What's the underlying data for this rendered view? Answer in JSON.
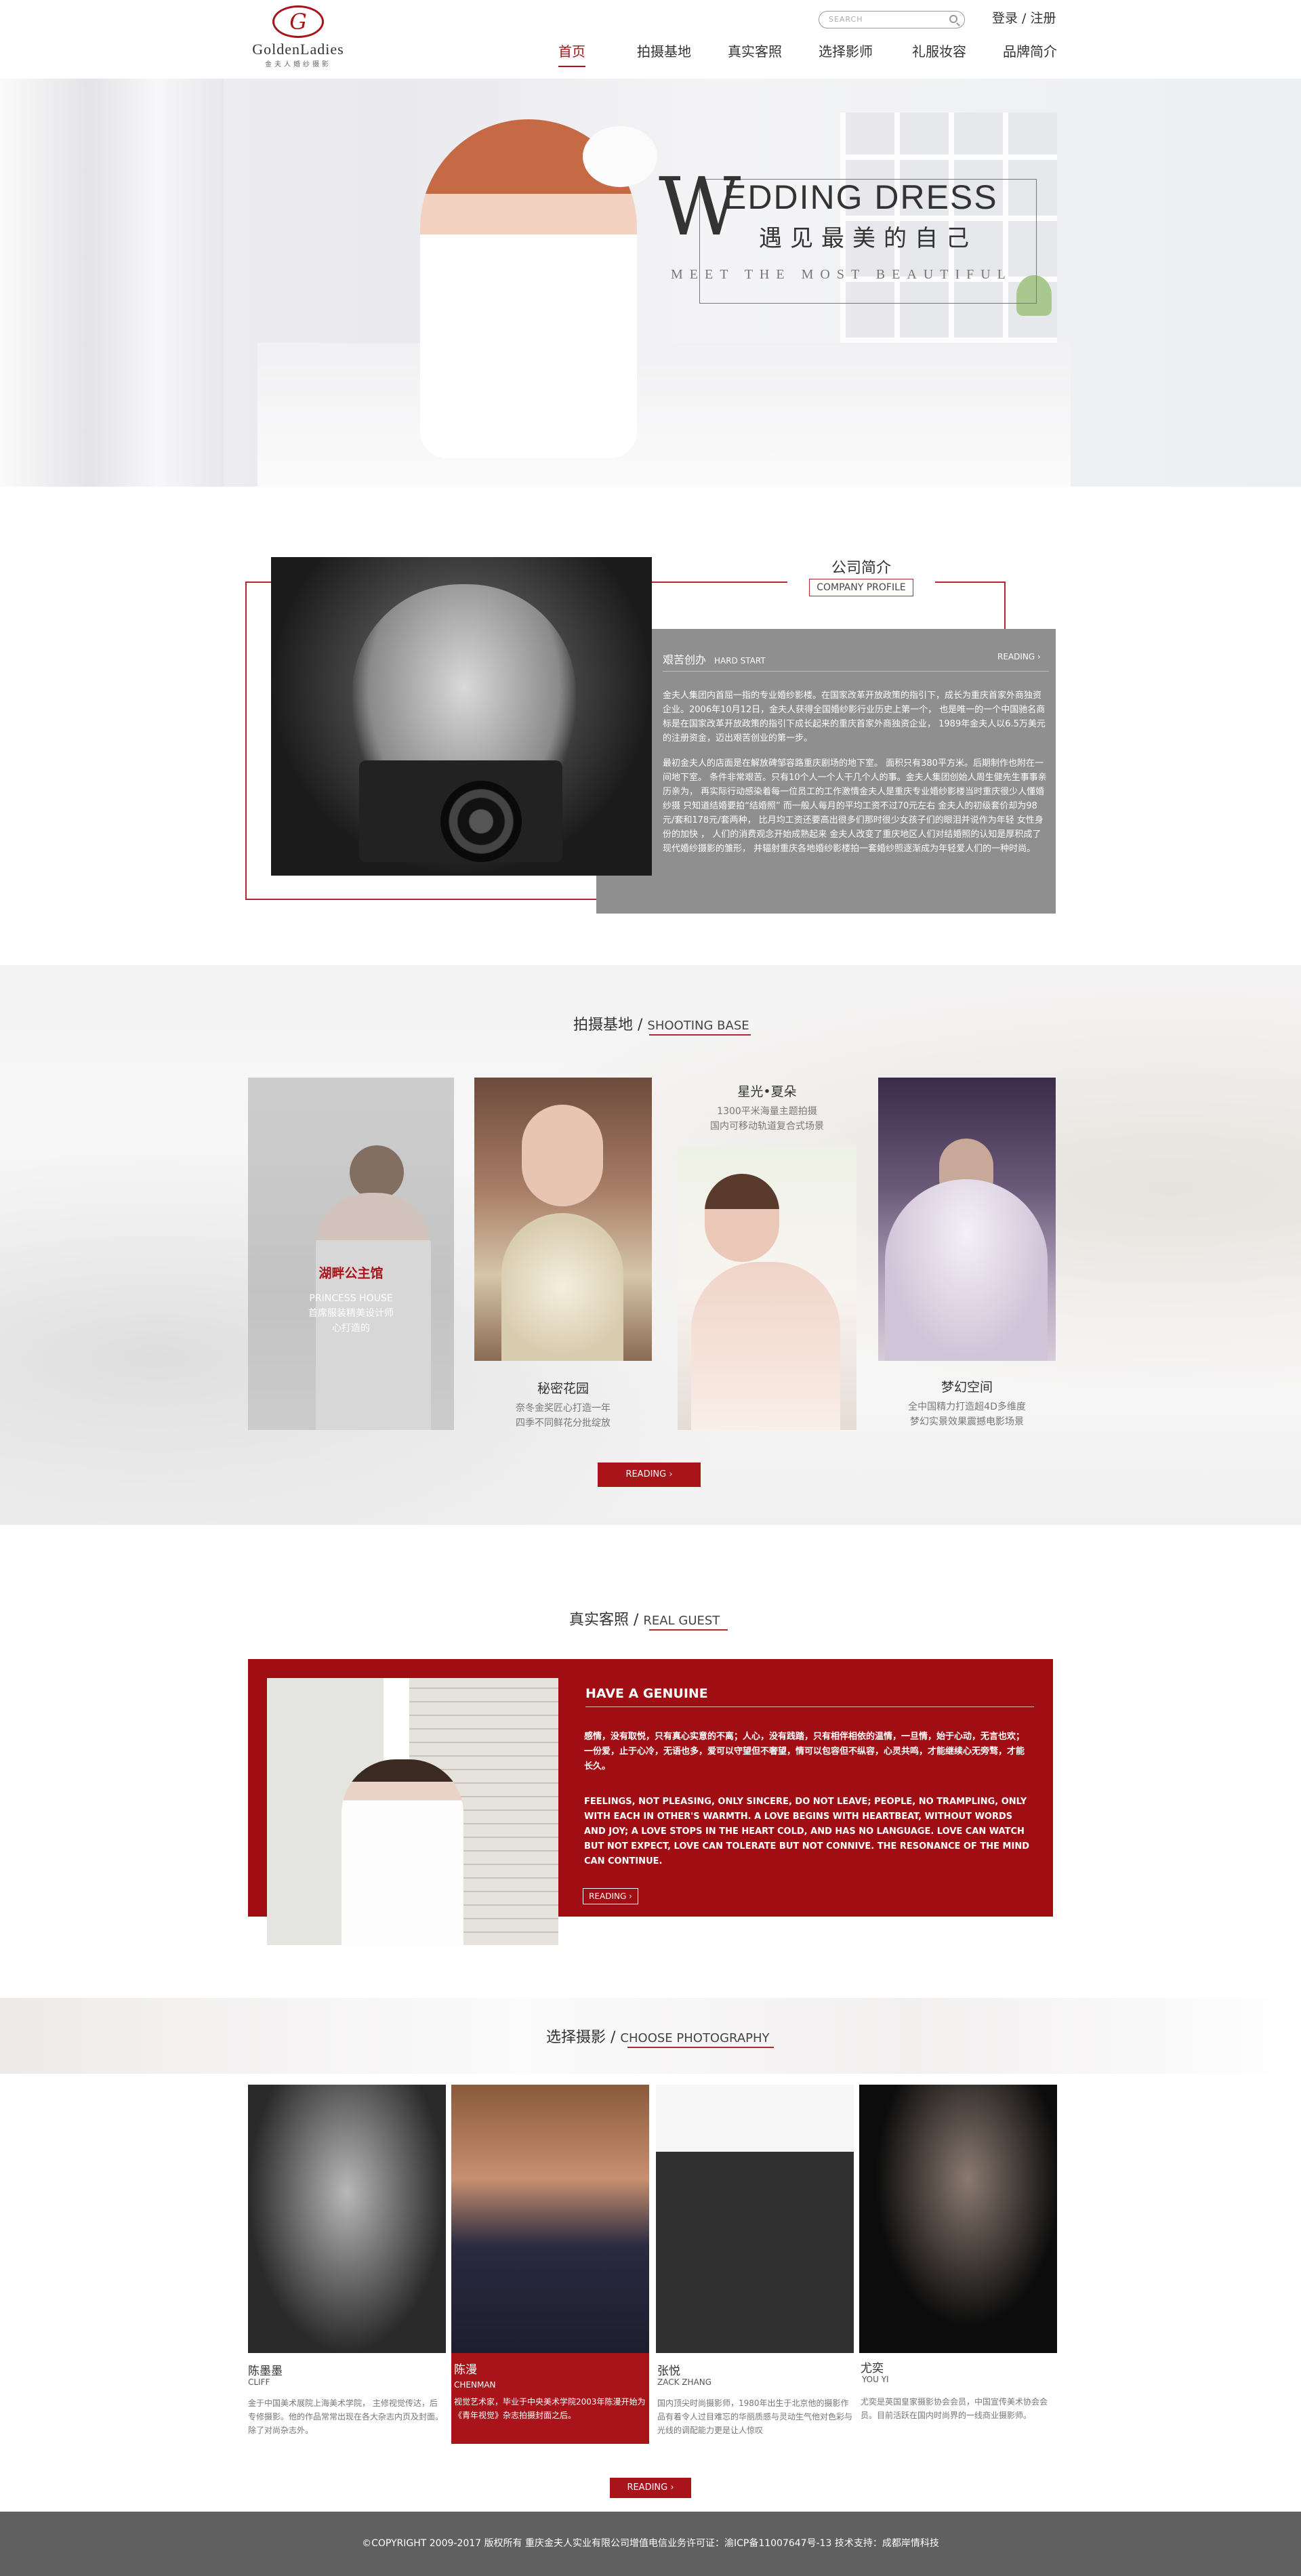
{
  "header": {
    "logo_name": "GoldenLadies",
    "logo_sub": "金夫人婚纱摄影",
    "search_placeholder": "SEARCH",
    "login": "登录 / 注册",
    "nav": [
      "首页",
      "拍摄基地",
      "真实客照",
      "选择影师",
      "礼服妆容",
      "品牌简介"
    ],
    "active_nav": "首页"
  },
  "hero": {
    "big_letter": "W",
    "title": "EDDING DRESS",
    "subtitle_cn": "遇见最美的自己",
    "subtitle_en": "MEET THE MOST BEAUTIFUL",
    "slides": 3,
    "active_slide": 2
  },
  "profile": {
    "title_cn": "公司简介",
    "title_en": "COMPANY PROFILE",
    "sub_cn": "艰苦创办",
    "sub_en": "HARD START",
    "reading": "READING  ›",
    "p1": "金夫人集团内首屈一指的专业婚纱影楼。在国家改革开放政策的指引下，成长为重庆首家外商独资企业。2006年10月12日，金夫人获得全国婚纱影行业历史上第一个，  也是唯一的一个中国驰名商标是在国家改革开放政策的指引下成长起来的重庆首家外商独资企业，  1989年金夫人以6.5万美元的注册资金，迈出艰苦创业的第一步。",
    "p2": "最初金夫人的店面是在解放碑邹容路重庆剧场的地下室。  面积只有380平方米。后期制作也附在一间地下室。  条件非常艰苦。只有10个人一个人干几个人的事。金夫人集团创始人周生健先生事事亲历亲为，  再实际行动感染着每一位员工的工作激情金夫人是重庆专业婚纱影楼当时重庆很少人懂婚纱摄    只知道结婚要拍“结婚照”    而一般人每月的平均工资不过70元左右 金夫人的初级套价却为98元/套和178元/套两种，  比月均工资还要高出很多们那时很少女孩子们的眼泪并说作为年轻 女性身份的加快 ，  人们的消费观念开始成熟起来    金夫人改变了重庆地区人们对结婚照的认知是厚积成了现代婚纱摄影的雏形，  并辐射重庆各地婚纱影楼拍一套婚纱照逐渐成为年轻爱人们的一种时尚。"
  },
  "shooting": {
    "title_cn": "拍摄基地",
    "title_en": "SHOOTING BASE",
    "cards": [
      {
        "name": "湖畔公主馆",
        "en": "PRINCESS HOUSE",
        "desc1": "首席服装精美设计师",
        "desc2": "心打造的"
      },
      {
        "name": "秘密花园",
        "desc1": "奈冬金奖匠心打造一年",
        "desc2": "四季不同鲜花分批绽放"
      },
      {
        "name": "星光•夏朵",
        "desc1": "1300平米海量主题拍摄",
        "desc2": "国内可移动轨道复合式场景"
      },
      {
        "name": "梦幻空间",
        "desc1": "全中国精力打造超4D多维度",
        "desc2": "梦幻实景效果震撼电影场景"
      }
    ],
    "button": "READING  ›"
  },
  "guest": {
    "title_cn": "真实客照",
    "title_en": "REAL GUEST",
    "headline": "HAVE A GENUINE",
    "cn_text": "感情，没有取悦，只有真心实意的不离；人心，没有践踏，只有相伴相依的温情，一旦情，始于心动，无言也欢；一份爱，止于心冷，无语也多，爱可以守望但不奢望，情可以包容但不纵容，心灵共鸣，才能继续心无旁骛，才能长久。",
    "en_text": "FEELINGS, NOT PLEASING, ONLY SINCERE, DO NOT LEAVE; PEOPLE, NO TRAMPLING, ONLY WITH EACH IN OTHER'S WARMTH. A LOVE BEGINS WITH HEARTBEAT, WITHOUT WORDS AND JOY; A LOVE STOPS IN THE HEART COLD, AND HAS NO LANGUAGE. LOVE CAN WATCH BUT NOT EXPECT, LOVE CAN TOLERATE BUT NOT CONNIVE. THE RESONANCE OF THE MIND CAN CONTINUE.",
    "button": "READING  ›"
  },
  "photographers": {
    "title_cn": "选择摄影",
    "title_en": "CHOOSE PHOTOGRAPHY",
    "items": [
      {
        "name": "陈墨墨",
        "en": "CLIFF",
        "desc": "金于中国美术展院上海美术学院，  主修视觉传达，后专修摄影。他的作品常常出现在各大杂志内页及封面。除了对尚杂志外。"
      },
      {
        "name": "陈漫",
        "en": "CHENMAN",
        "desc": "视觉艺术家，毕业于中央美术学院2003年陈漫开始为《青年视觉》杂志拍摄封面之后。"
      },
      {
        "name": "张悦",
        "en": "ZACK ZHANG",
        "desc": "国内顶尖时尚摄影师，1980年出生于北京他的摄影作品有着令人过目难忘的华丽质感与灵动生气他对色彩与光线的调配能力更是让人惊叹"
      },
      {
        "name": "尤奕",
        "en": "YOU YI",
        "desc": "尤奕是英国皇家摄影协会会员，中国宣传美术协会会员。目前活跃在国内时尚界的一线商业摄影师。"
      }
    ],
    "button": "READING  ›"
  },
  "footer": {
    "text": "©COPYRIGHT 2009-2017 版权所有 重庆金夫人实业有限公司增值电信业务许可证：渝ICP备11007647号-13  技术支持：成都岸情科技"
  },
  "colors": {
    "accent": "#a8141a",
    "gray_panel": "#8f8f8f",
    "footer": "#606060"
  }
}
